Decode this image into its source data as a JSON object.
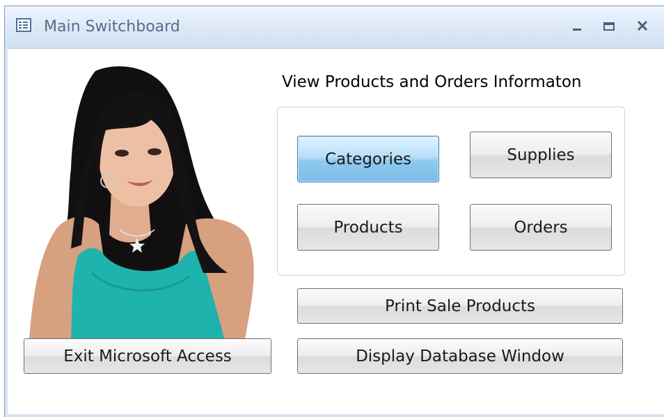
{
  "window": {
    "title": "Main Switchboard"
  },
  "section": {
    "heading": "View Products and Orders Informaton"
  },
  "buttons": {
    "categories": "Categories",
    "supplies": "Supplies",
    "products": "Products",
    "orders": "Orders",
    "print_sale_products": "Print Sale Products",
    "display_database_window": "Display Database Window",
    "exit_access": "Exit Microsoft Access"
  },
  "colors": {
    "titlebar": "#dce8f7",
    "active_button": "#8ec9ef",
    "top_color": "#1fb3ae"
  },
  "icons": {
    "app": "form-icon",
    "minimize": "minimize-icon",
    "maximize": "maximize-icon",
    "close": "close-icon"
  }
}
